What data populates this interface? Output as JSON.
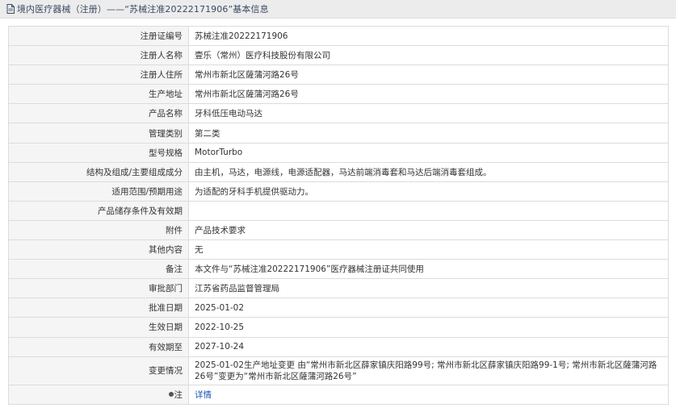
{
  "header": {
    "title": "境内医疗器械（注册）——“苏械注准20222171906”基本信息"
  },
  "rows": [
    {
      "label": "注册证编号",
      "value": "苏械注准20222171906"
    },
    {
      "label": "注册人名称",
      "value": "壹乐（常州）医疗科技股份有限公司"
    },
    {
      "label": "注册人住所",
      "value": "常州市新北区薩蒲河路26号"
    },
    {
      "label": "生产地址",
      "value": "常州市新北区薩蒲河路26号"
    },
    {
      "label": "产品名称",
      "value": "牙科低压电动马达"
    },
    {
      "label": "管理类别",
      "value": "第二类"
    },
    {
      "label": "型号规格",
      "value": "MotorTurbo"
    },
    {
      "label": "结构及组成/主要组成成分",
      "value": "由主机，马达，电源线，电源适配器，马达前端消毒套和马达后端消毒套组成。"
    },
    {
      "label": "适用范围/预期用途",
      "value": "为适配的牙科手机提供驱动力。"
    },
    {
      "label": "产品储存条件及有效期",
      "value": ""
    },
    {
      "label": "附件",
      "value": "产品技术要求"
    },
    {
      "label": "其他内容",
      "value": "无"
    },
    {
      "label": "备注",
      "value": "本文件与“苏械注准20222171906”医疗器械注册证共同使用"
    },
    {
      "label": "审批部门",
      "value": "江苏省药品监督管理局"
    },
    {
      "label": "批准日期",
      "value": "2025-01-02"
    },
    {
      "label": "生效日期",
      "value": "2022-10-25"
    },
    {
      "label": "有效期至",
      "value": "2027-10-24"
    },
    {
      "label": "变更情况",
      "value": "2025-01-02生产地址变更 由“常州市新北区薛家镇庆阳路99号; 常州市新北区薛家镇庆阳路99-1号; 常州市新北区薩蒲河路26号”变更为“常州市新北区薩蒲河路26号”"
    }
  ],
  "footer_row": {
    "label": "注",
    "link": "详情"
  },
  "icons": {
    "title_icon": "document-icon",
    "note_icon": "pin-icon"
  },
  "colors": {
    "title_bg": "#ececec",
    "label_bg": "#f5f5f5",
    "border": "#dcdcdc",
    "link": "#1a57b8"
  }
}
